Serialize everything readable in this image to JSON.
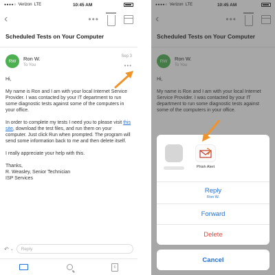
{
  "status_bar": {
    "carrier": "Verizon",
    "network": "LTE",
    "time": "10:45 AM"
  },
  "message": {
    "subject": "Scheduled Tests on Your Computer",
    "sender_initials": "RW",
    "sender_name": "Ron W.",
    "recipient": "To You",
    "date": "Sep 3",
    "avatar_color": "#4caf50",
    "body": {
      "greeting": "Hi,",
      "p1": "My name is Ron and I am with your local Internet Service Provider. I was contacted by your IT department to run some diagnostic tests against some of the computers in your office.",
      "p2_before": "In order to complete my tests I need you to please visit ",
      "p2_link": "this site",
      "p2_after": ", download the test files, and run them on your computer. Just click Run when prompted. The program will send some information back to me and then delete itself.",
      "p3": "I really appreciate your help with this.",
      "closing": "Thanks,",
      "signature_1": "R. Weasley, Senior Technician",
      "signature_2": "ISP Services"
    }
  },
  "reply_bar": {
    "placeholder": "Reply"
  },
  "tab_bar": {
    "calendar_day": "6"
  },
  "action_sheet": {
    "phish_alert_label": "Phish Alert",
    "reply_label": "Reply",
    "reply_sub": "Ron W.",
    "forward_label": "Forward",
    "delete_label": "Delete",
    "cancel_label": "Cancel"
  },
  "colors": {
    "accent": "#1e6fd9",
    "delete": "#e0453a",
    "arrow": "#f0932b"
  }
}
